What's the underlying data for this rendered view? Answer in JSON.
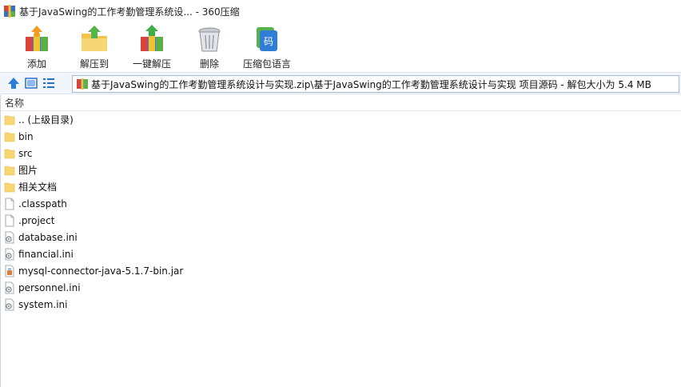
{
  "window": {
    "title": "基于JavaSwing的工作考勤管理系统设... - 360压缩"
  },
  "toolbar": {
    "items": [
      {
        "id": "add",
        "label": "添加",
        "icon": "add-archive-icon"
      },
      {
        "id": "extract",
        "label": "解压到",
        "icon": "extract-to-icon"
      },
      {
        "id": "one-click",
        "label": "一键解压",
        "icon": "one-click-extract-icon"
      },
      {
        "id": "delete",
        "label": "删除",
        "icon": "trash-icon"
      },
      {
        "id": "language",
        "label": "压缩包语言",
        "icon": "encoding-icon"
      }
    ]
  },
  "addressbar": {
    "path": "基于JavaSwing的工作考勤管理系统设计与实现.zip\\基于JavaSwing的工作考勤管理系统设计与实现 项目源码 - 解包大小为 5.4 MB"
  },
  "list": {
    "column_name": "名称",
    "items": [
      {
        "name": ".. (上级目录)",
        "type": "folder"
      },
      {
        "name": "bin",
        "type": "folder"
      },
      {
        "name": "src",
        "type": "folder"
      },
      {
        "name": "图片",
        "type": "folder"
      },
      {
        "name": "相关文档",
        "type": "folder"
      },
      {
        "name": ".classpath",
        "type": "file"
      },
      {
        "name": ".project",
        "type": "file"
      },
      {
        "name": "database.ini",
        "type": "ini"
      },
      {
        "name": "financial.ini",
        "type": "ini"
      },
      {
        "name": "mysql-connector-java-5.1.7-bin.jar",
        "type": "jar"
      },
      {
        "name": "personnel.ini",
        "type": "ini"
      },
      {
        "name": "system.ini",
        "type": "ini"
      }
    ]
  },
  "colors": {
    "folder": "#f7d774",
    "accent_blue": "#2a6fc9",
    "address_bg": "#f1f6fd"
  }
}
